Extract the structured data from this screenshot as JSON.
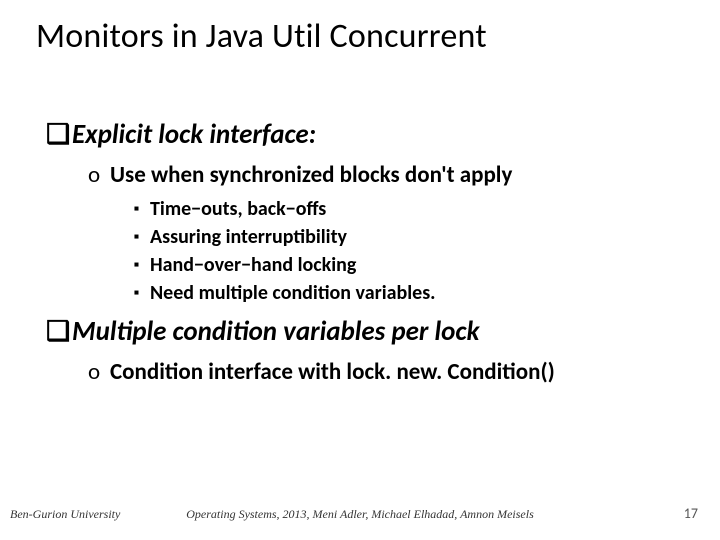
{
  "title": "Monitors in Java Util Concurrent",
  "bullets": {
    "h1a": "Explicit lock interface:",
    "h2a": "Use when synchronized blocks don't apply",
    "b1": "Time−outs, back−offs",
    "b2": "Assuring interruptibility",
    "b3": "Hand−over−hand locking",
    "b4": "Need multiple condition variables.",
    "h1b": "Multiple condition variables per lock",
    "h2b": "Condition interface with lock. new. Condition()"
  },
  "footer": {
    "left": "Ben-Gurion University",
    "center": "Operating Systems, 2013, Meni Adler, Michael Elhadad, Amnon Meisels",
    "page": "17"
  },
  "glyphs": {
    "box": "❑",
    "circle": "o",
    "square": "▪"
  }
}
